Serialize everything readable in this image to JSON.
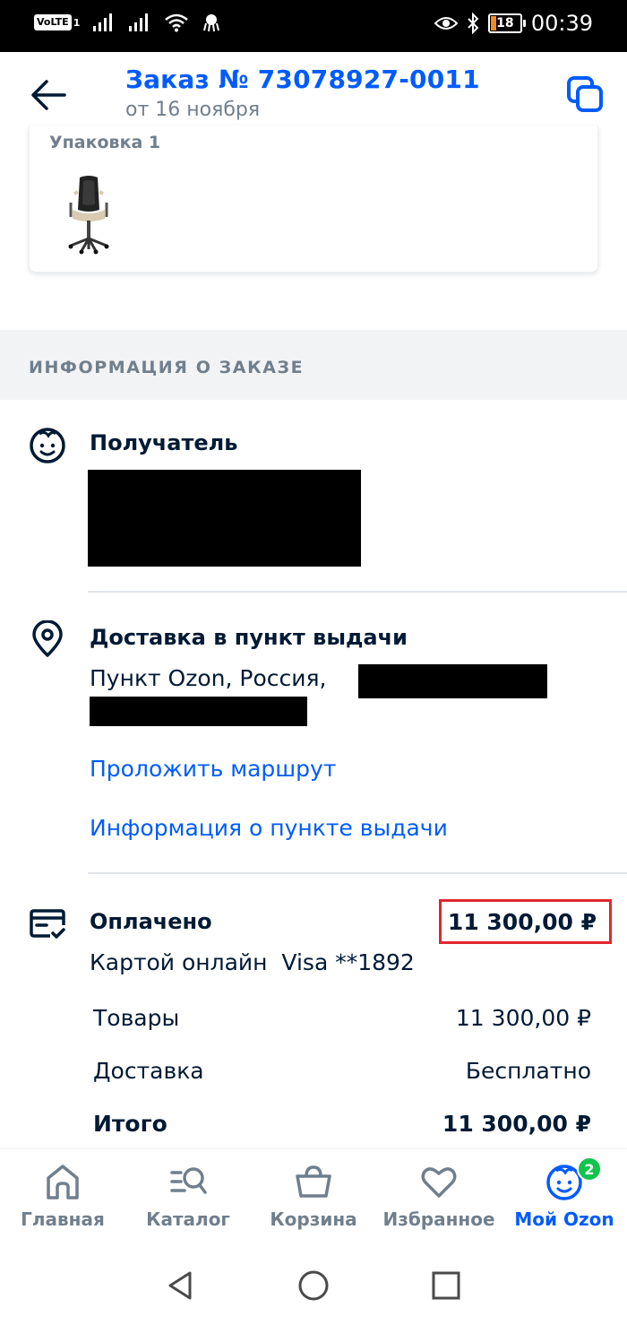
{
  "status_bar": {
    "volte": "VoLTE",
    "sim": "1",
    "time": "00:39",
    "battery": "18"
  },
  "header": {
    "title": "Заказ № 73078927-0011",
    "subtitle": "от 16 ноября"
  },
  "package": {
    "title": "Упаковка 1"
  },
  "section": {
    "title": "ИНФОРМАЦИЯ О ЗАКАЗЕ"
  },
  "recipient": {
    "title": "Получатель"
  },
  "delivery": {
    "title": "Доставка в пункт выдачи",
    "address_prefix": "Пункт Ozon, Россия,",
    "route_link": "Проложить маршрут",
    "info_link": "Информация о пункте выдачи"
  },
  "payment": {
    "title": "Оплачено",
    "amount": "11 300,00 ₽",
    "method": "Картой онлайн  Visa **1892",
    "rows": [
      {
        "label": "Товары",
        "value": "11 300,00 ₽"
      },
      {
        "label": "Доставка",
        "value": "Бесплатно"
      },
      {
        "label": "Итого",
        "value": "11 300,00 ₽"
      }
    ]
  },
  "bottom_nav": {
    "items": [
      {
        "label": "Главная"
      },
      {
        "label": "Каталог"
      },
      {
        "label": "Корзина"
      },
      {
        "label": "Избранное"
      },
      {
        "label": "Мой Ozon"
      }
    ],
    "badge": "2"
  },
  "colors": {
    "accent": "#005bff",
    "text": "#001a34",
    "muted": "#707f8d",
    "badge": "#10c44c",
    "highlight": "#e2262f"
  }
}
